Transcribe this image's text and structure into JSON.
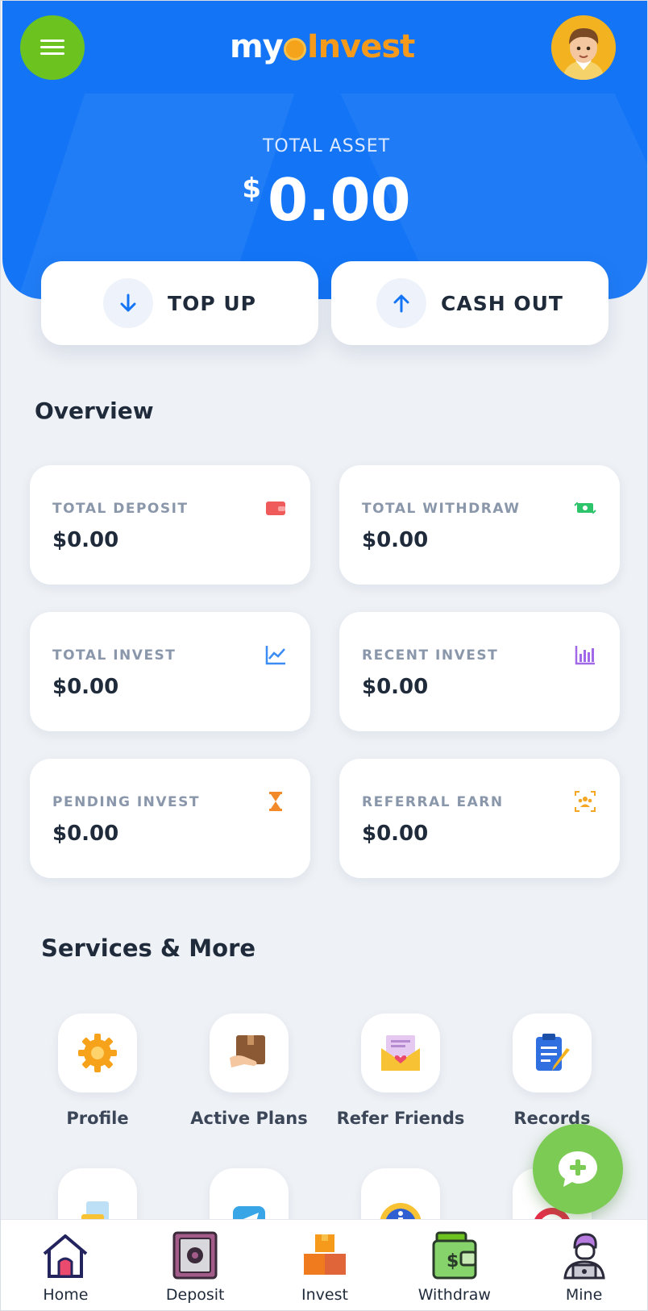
{
  "header": {
    "logo_my": "my",
    "logo_invest": "Invest",
    "total_label": "TOTAL ASSET",
    "currency": "$",
    "total_amount": "0.00"
  },
  "actions": {
    "top_up": "TOP UP",
    "cash_out": "CASH OUT"
  },
  "overview": {
    "title": "Overview",
    "cards": [
      {
        "title": "TOTAL DEPOSIT",
        "value": "$0.00",
        "icon": "wallet-icon"
      },
      {
        "title": "TOTAL WITHDRAW",
        "value": "$0.00",
        "icon": "money-exchange-icon"
      },
      {
        "title": "TOTAL INVEST",
        "value": "$0.00",
        "icon": "line-chart-icon"
      },
      {
        "title": "RECENT INVEST",
        "value": "$0.00",
        "icon": "bar-chart-icon"
      },
      {
        "title": "PENDING INVEST",
        "value": "$0.00",
        "icon": "hourglass-icon"
      },
      {
        "title": "REFERRAL EARN",
        "value": "$0.00",
        "icon": "team-icon"
      }
    ]
  },
  "services": {
    "title": "Services & More",
    "items": [
      {
        "label": "Profile",
        "icon": "gear-icon"
      },
      {
        "label": "Active Plans",
        "icon": "package-icon"
      },
      {
        "label": "Refer Friends",
        "icon": "envelope-heart-icon"
      },
      {
        "label": "Records",
        "icon": "clipboard-icon"
      }
    ]
  },
  "nav": {
    "items": [
      {
        "label": "Home",
        "icon": "home-icon"
      },
      {
        "label": "Deposit",
        "icon": "safe-icon"
      },
      {
        "label": "Invest",
        "icon": "boxes-icon"
      },
      {
        "label": "Withdraw",
        "icon": "wallet-icon"
      },
      {
        "label": "Mine",
        "icon": "user-icon"
      }
    ]
  },
  "colors": {
    "primary": "#1375f6",
    "accent_green": "#6cc31f",
    "logo_orange": "#f59a1b",
    "fab_green": "#7ccb54",
    "background": "#eef1f5"
  }
}
